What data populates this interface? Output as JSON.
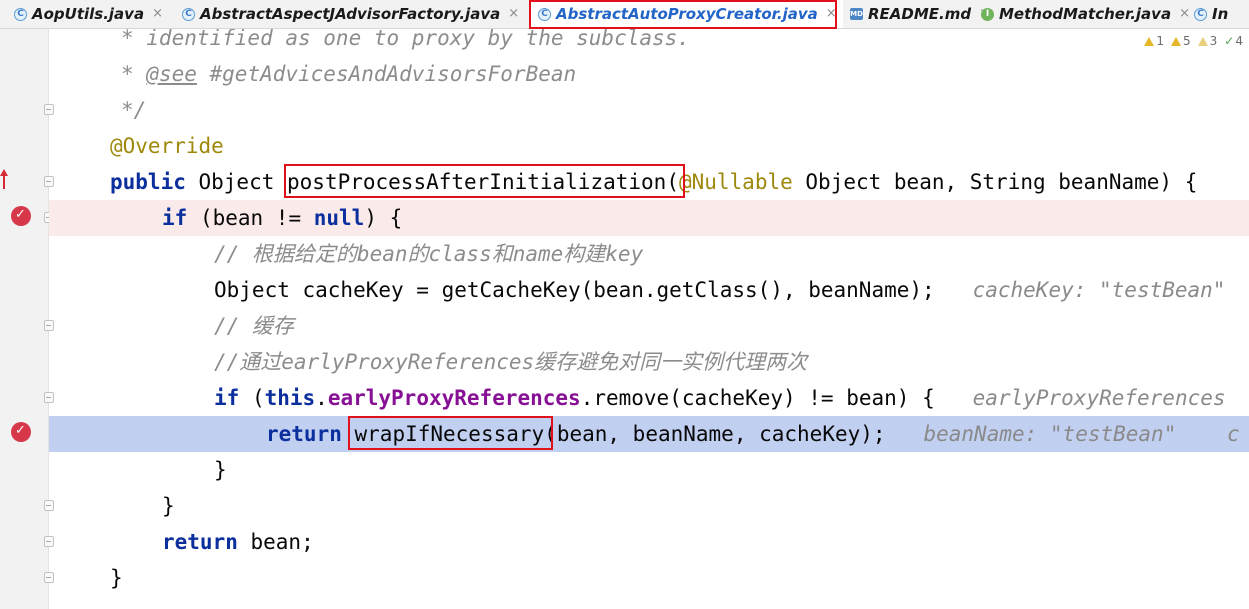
{
  "tabs": [
    {
      "label": "AopUtils.java",
      "icon": "class-icon",
      "active": false
    },
    {
      "label": "AbstractAspectJAdvisorFactory.java",
      "icon": "class-icon",
      "active": false
    },
    {
      "label": "AbstractAutoProxyCreator.java",
      "icon": "class-icon",
      "active": true
    },
    {
      "label": "README.md",
      "icon": "markdown-icon",
      "active": false
    },
    {
      "label": "MethodMatcher.java",
      "icon": "interface-icon",
      "active": false
    },
    {
      "label": "In",
      "icon": "class-icon",
      "active": false
    }
  ],
  "icon_glyphs": {
    "class": "C",
    "interface": "I",
    "markdown": "MD",
    "close": "×"
  },
  "inspections": {
    "errors": "1",
    "warnings": "5",
    "weak_warnings": "3",
    "ok": "4"
  },
  "code": {
    "l1_doc": "* identified as one to proxy by the subclass.",
    "l2_doc_star": "* ",
    "l2_doc_tag": "@see",
    "l2_doc_ref": " #getAdvicesAndAdvisorsForBean",
    "l3_doc": "*/",
    "l4_ann": "@Override",
    "l5_public": "public",
    "l5_type": " Object ",
    "l5_method": "postProcessAfterInitialization",
    "l5_paren": "(",
    "l5_nullable": "@Nullable",
    "l5_rest": " Object bean, String beanName) {",
    "l6_if": "if",
    "l6_mid": " (bean != ",
    "l6_null": "null",
    "l6_end": ") {",
    "l7_comment": "// 根据给定的bean的class和name构建key",
    "l8_code": "Object cacheKey = getCacheKey(bean.getClass(), beanName);",
    "l8_hint": "cacheKey: \"testBean\"",
    "l9_comment": "// 缓存",
    "l10_comment": "//通过earlyProxyReferences缓存避免对同一实例代理两次",
    "l11_if": "if",
    "l11_open": " (",
    "l11_this": "this",
    "l11_dot": ".",
    "l11_field": "earlyProxyReferences",
    "l11_rest": ".remove(cacheKey) != bean) {",
    "l11_hint": "earlyProxyReferences",
    "l12_return": "return",
    "l12_method": "wrapIfNecessary",
    "l12_rest": "(bean, beanName, cacheKey);",
    "l12_hint": "beanName: \"testBean\"",
    "l12_hint2": "c",
    "l13_brace": "}",
    "l14_brace": "}",
    "l15_return": "return",
    "l15_rest": " bean;",
    "l16_brace": "}"
  }
}
